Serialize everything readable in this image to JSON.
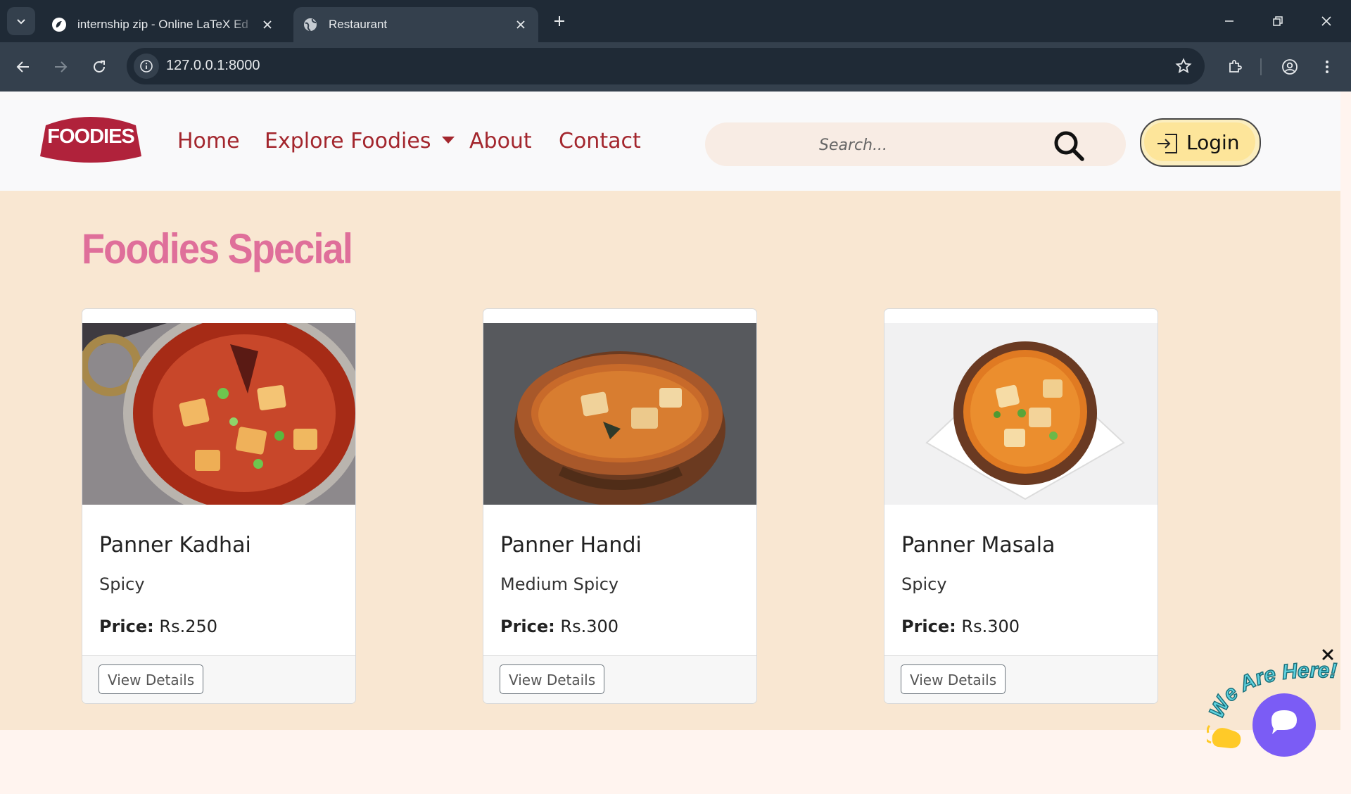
{
  "browser": {
    "tabs": [
      {
        "title": "internship zip - Online LaTeX Ed",
        "active": false
      },
      {
        "title": "Restaurant",
        "active": true
      }
    ],
    "url": "127.0.0.1:8000"
  },
  "site": {
    "logo_text": "FOODIES",
    "nav": {
      "home": "Home",
      "explore": "Explore Foodies",
      "about": "About",
      "contact": "Contact"
    },
    "search_placeholder": "Search...",
    "login_label": "Login"
  },
  "specials": {
    "title": "Foodies Special",
    "price_label": "Price:",
    "button_label": "View Details",
    "items": [
      {
        "name": "Panner Kadhai",
        "spice": "Spicy",
        "price": "Rs.250"
      },
      {
        "name": "Panner Handi",
        "spice": "Medium Spicy",
        "price": "Rs.300"
      },
      {
        "name": "Panner Masala",
        "spice": "Spicy",
        "price": "Rs.300"
      }
    ]
  },
  "chat_widget": {
    "badge_text": "We Are Here!"
  },
  "colors": {
    "brand_red": "#a3262d",
    "title_pink": "#df6f9a",
    "section_bg": "#f9e7d2",
    "chat_purple": "#7b5cf5"
  }
}
